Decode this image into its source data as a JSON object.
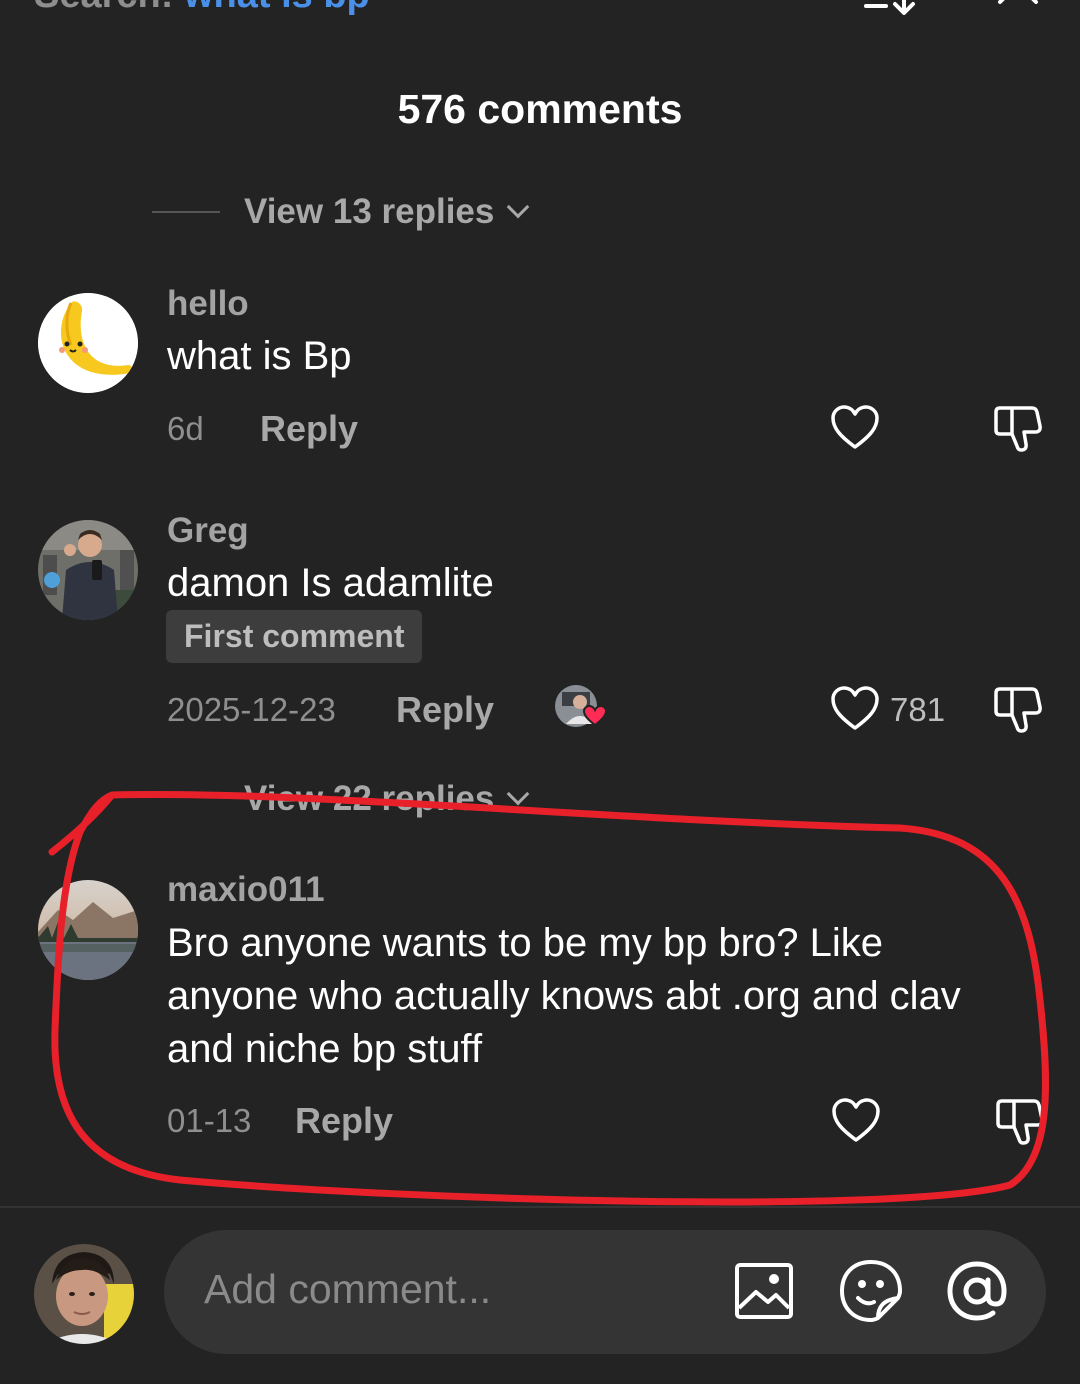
{
  "header": {
    "search_prefix": "Search:",
    "search_query": "what is bp",
    "comment_count_title": "576 comments"
  },
  "replies": [
    {
      "label": "View 13 replies"
    },
    {
      "label": "View 22 replies"
    }
  ],
  "comments": [
    {
      "username": "hello",
      "text": "what is Bp",
      "date": "6d",
      "reply_label": "Reply",
      "like_count": ""
    },
    {
      "username": "Greg",
      "text": "damon Is adamlite",
      "badge": "First comment",
      "date": "2025-12-23",
      "reply_label": "Reply",
      "like_count": "781"
    },
    {
      "username": "maxio011",
      "text_lines": [
        "Bro anyone wants to be my bp bro? Like",
        "anyone who actually knows abt .org and clav",
        "and niche bp stuff"
      ],
      "date": "01-13",
      "reply_label": "Reply",
      "like_count": ""
    }
  ],
  "composer": {
    "placeholder": "Add comment..."
  },
  "icons": [
    "sort-icon",
    "close-icon",
    "heart-icon",
    "dislike-icon",
    "image-icon",
    "emoji-icon",
    "mention-icon"
  ],
  "colors": {
    "background": "#232323",
    "search_query": "#4a90e8",
    "annotation_red": "#e8202a",
    "heart_badge": "#ff2d55"
  }
}
